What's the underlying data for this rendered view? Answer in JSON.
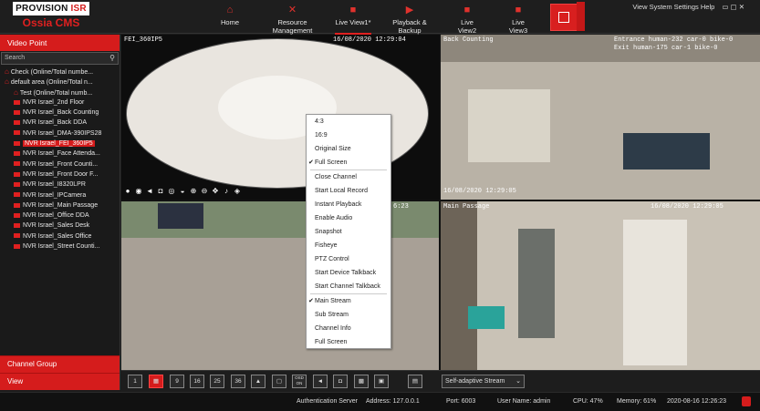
{
  "header": {
    "logo_brand_left": "PROVISION",
    "logo_brand_right": "ISR",
    "logo_product": "Ossia CMS",
    "nav": [
      {
        "label": "Home",
        "icon": "home-icon"
      },
      {
        "label": "Resource Management",
        "icon": "tools-icon"
      },
      {
        "label": "Live View1*",
        "icon": "camera-icon"
      },
      {
        "label": "Playback & Backup",
        "icon": "playback-icon"
      },
      {
        "label": "Live View2",
        "icon": "camera-icon"
      },
      {
        "label": "Live View3",
        "icon": "camera-icon"
      }
    ],
    "right_links": "View System Settings Help",
    "window_controls": "▭ ▢ ✕"
  },
  "sidebar": {
    "title": "Video Point",
    "search_placeholder": "Search",
    "tree": [
      {
        "label": "Check (Online/Total numbe...",
        "type": "group",
        "indent": 1
      },
      {
        "label": "default area (Online/Total n...",
        "type": "group",
        "indent": 1
      },
      {
        "label": "Test (Online/Total numb...",
        "type": "group",
        "indent": 2
      },
      {
        "label": "NVR Israel_2nd Floor",
        "type": "device",
        "indent": 2
      },
      {
        "label": "NVR Israel_Back Counting",
        "type": "device",
        "indent": 2
      },
      {
        "label": "NVR Israel_Back DDA",
        "type": "device",
        "indent": 2
      },
      {
        "label": "NVR Israel_DMA-390IPS28",
        "type": "device",
        "indent": 2
      },
      {
        "label": "NVR Israel_FEI_360IP5",
        "type": "device",
        "indent": 2,
        "selected": true
      },
      {
        "label": "NVR Israel_Face Attenda...",
        "type": "device",
        "indent": 2
      },
      {
        "label": "NVR Israel_Front Counti...",
        "type": "device",
        "indent": 2
      },
      {
        "label": "NVR Israel_Front Door F...",
        "type": "device",
        "indent": 2
      },
      {
        "label": "NVR Israel_I8320LPR",
        "type": "device",
        "indent": 2
      },
      {
        "label": "NVR Israel_IPCamera",
        "type": "device",
        "indent": 2
      },
      {
        "label": "NVR Israel_Main Passage",
        "type": "device",
        "indent": 2
      },
      {
        "label": "NVR Israel_Office DDA",
        "type": "device",
        "indent": 2
      },
      {
        "label": "NVR Israel_Sales Desk",
        "type": "device",
        "indent": 2
      },
      {
        "label": "NVR Israel_Sales Office",
        "type": "device",
        "indent": 2
      },
      {
        "label": "NVR Israel_Street Counti...",
        "type": "device",
        "indent": 2
      }
    ],
    "bottom": [
      "Channel Group",
      "View"
    ]
  },
  "cameras": {
    "c1": {
      "name": "FEI_360IP5",
      "time": "16/08/2020 12:29:04"
    },
    "c2": {
      "name": "Back Counting",
      "overlay_line1": "Entrance  human-232 car-0 bike-0",
      "overlay_line2": "Exit      human-175 car-1 bike-0",
      "time": "16/08/2020 12:29:05"
    },
    "c3": {
      "time": "6:23"
    },
    "c4": {
      "name": "Main Passage",
      "time": "16/08/2020 12:29:05"
    }
  },
  "context_menu": [
    {
      "label": "4:3"
    },
    {
      "label": "16:9"
    },
    {
      "label": "Original Size"
    },
    {
      "label": "Full Screen",
      "checked": true
    },
    {
      "sep": true
    },
    {
      "label": "Close Channel"
    },
    {
      "label": "Start Local Record"
    },
    {
      "label": "Instant Playback"
    },
    {
      "label": "Enable Audio"
    },
    {
      "label": "Snapshot"
    },
    {
      "label": "Fisheye"
    },
    {
      "label": "PTZ Control"
    },
    {
      "label": "Start Device Talkback"
    },
    {
      "label": "Start Channel Talkback"
    },
    {
      "sep": true
    },
    {
      "label": "Main Stream",
      "checked": true
    },
    {
      "label": "Sub Stream"
    },
    {
      "label": "Channel Info"
    },
    {
      "label": "Full Screen"
    }
  ],
  "bottom_toolbar": {
    "layouts": [
      "1",
      "4",
      "9",
      "16",
      "25",
      "36"
    ],
    "osd_label": "OSD ON",
    "stream_select": "Self-adaptive Stream"
  },
  "status": {
    "server": "Authentication Server",
    "address": "Address: 127.0.0.1",
    "port": "Port: 6003",
    "user": "User Name: admin",
    "cpu": "CPU: 47%",
    "memory": "Memory: 61%",
    "datetime": "2020-08-16 12:26:23"
  },
  "colors": {
    "accent": "#d51c1c",
    "background": "#1c1c1c"
  }
}
